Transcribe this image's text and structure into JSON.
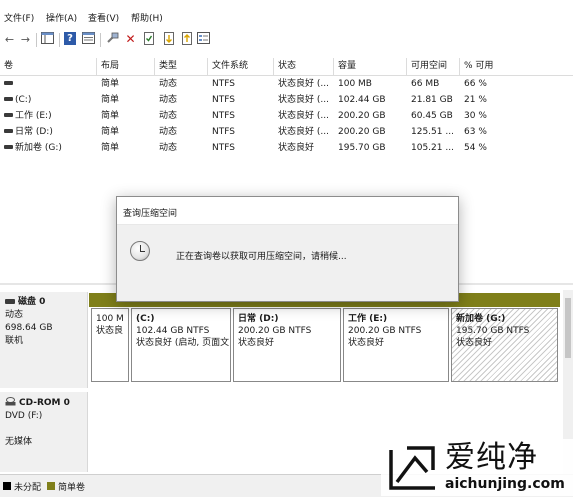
{
  "menu": [
    {
      "label": "文件(F)"
    },
    {
      "label": "操作(A)"
    },
    {
      "label": "查看(V)"
    },
    {
      "label": "帮助(H)"
    }
  ],
  "toolbar": {
    "back_icon": "←",
    "forward_icon": "→",
    "help_glyph": "?",
    "delete_glyph": "✕"
  },
  "volume_table": {
    "columns": [
      "卷",
      "布局",
      "类型",
      "文件系统",
      "状态",
      "容量",
      "可用空间",
      "% 可用"
    ],
    "rows": [
      {
        "volume": "",
        "layout": "简单",
        "type": "动态",
        "fs": "NTFS",
        "status": "状态良好 (...",
        "capacity": "100 MB",
        "free": "66 MB",
        "pct": "66 %"
      },
      {
        "volume": "(C:)",
        "layout": "简单",
        "type": "动态",
        "fs": "NTFS",
        "status": "状态良好 (...",
        "capacity": "102.44 GB",
        "free": "21.81 GB",
        "pct": "21 %"
      },
      {
        "volume": "工作 (E:)",
        "layout": "简单",
        "type": "动态",
        "fs": "NTFS",
        "status": "状态良好 (...",
        "capacity": "200.20 GB",
        "free": "60.45 GB",
        "pct": "30 %"
      },
      {
        "volume": "日常 (D:)",
        "layout": "简单",
        "type": "动态",
        "fs": "NTFS",
        "status": "状态良好 (...",
        "capacity": "200.20 GB",
        "free": "125.51 ...",
        "pct": "63 %"
      },
      {
        "volume": "新加卷 (G:)",
        "layout": "简单",
        "type": "动态",
        "fs": "NTFS",
        "status": "状态良好",
        "capacity": "195.70 GB",
        "free": "105.21 ...",
        "pct": "54 %"
      }
    ]
  },
  "disk0": {
    "name": "磁盘 0",
    "type": "动态",
    "size": "698.64 GB",
    "status": "联机",
    "bar_color": "#7f7f1a",
    "partitions": [
      {
        "name": "",
        "size": "100 M",
        "status": "状态良"
      },
      {
        "name": "(C:)",
        "size": "102.44 GB NTFS",
        "status": "状态良好 (启动, 页面文"
      },
      {
        "name": "日常  (D:)",
        "size": "200.20 GB NTFS",
        "status": "状态良好"
      },
      {
        "name": "工作  (E:)",
        "size": "200.20 GB NTFS",
        "status": "状态良好"
      },
      {
        "name": "新加卷  (G:)",
        "size": "195.70 GB NTFS",
        "status": "状态良好"
      }
    ]
  },
  "cdrom0": {
    "name": "CD-ROM 0",
    "drive": "DVD (F:)",
    "media": "无媒体"
  },
  "legend": [
    {
      "label": "未分配",
      "color": "#000000"
    },
    {
      "label": "简单卷",
      "color": "#7f7f1a"
    }
  ],
  "dialog": {
    "title": "查询压缩空间",
    "message": "正在查询卷以获取可用压缩空间，请稍候..."
  },
  "watermark": {
    "brand": "爱纯净",
    "url": "aichunjing.com"
  }
}
